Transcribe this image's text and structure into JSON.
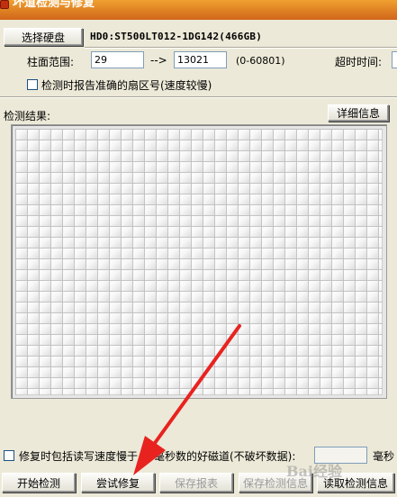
{
  "window": {
    "title": "坏道检测与修复"
  },
  "disk": {
    "select_button": "选择硬盘",
    "name": "HD0:ST500LT012-1DG142(466GB)"
  },
  "range": {
    "label": "柱面范围:",
    "start": "29",
    "separator": "-->",
    "end": "13021",
    "limit": "(0-60801)",
    "timeout_label": "超时时间:"
  },
  "options": {
    "accurate_sector_label": "检测时报告准确的扇区号(速度较慢)",
    "accurate_sector_checked": false,
    "repair_slow_label": "修复时包括读写速度慢于",
    "repair_slow_suffix": "毫秒数的好磁道(不破坏数据):",
    "repair_slow_checked": false,
    "ms_value": "",
    "ms_unit": "毫秒"
  },
  "results": {
    "label": "检测结果:",
    "details_button": "详细信息"
  },
  "actions": {
    "start": "开始检测",
    "try_repair": "尝试修复",
    "save_report": "保存报表",
    "save_info": "保存检测信息",
    "read_info": "读取检测信息"
  },
  "annotation": {
    "arrow_color": "#e8231f",
    "watermark": "Bai经验"
  }
}
